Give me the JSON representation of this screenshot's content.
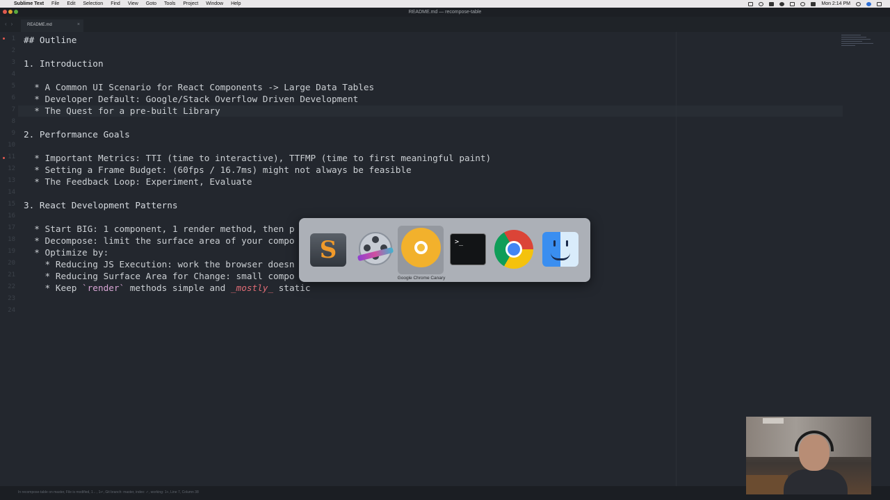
{
  "menubar": {
    "app": "Sublime Text",
    "items": [
      "File",
      "Edit",
      "Selection",
      "Find",
      "View",
      "Goto",
      "Tools",
      "Project",
      "Window",
      "Help"
    ],
    "clock": "Mon 2:14 PM"
  },
  "window": {
    "title": "README.md — recompose-table"
  },
  "tab": {
    "label": "README.md",
    "close": "×"
  },
  "editor": {
    "line_numbers": [
      "1",
      "2",
      "3",
      "4",
      "5",
      "6",
      "7",
      "8",
      "9",
      "10",
      "11",
      "12",
      "13",
      "14",
      "15",
      "16",
      "17",
      "18",
      "19",
      "20",
      "21",
      "22",
      "23",
      "24"
    ],
    "lines": {
      "l1": "## Outline",
      "l3": "1. Introduction",
      "l5": "  * A Common UI Scenario for React Components -> Large Data Tables",
      "l6": "  * Developer Default: Google/Stack Overflow Driven Development",
      "l7": "  * The Quest for a pre-built Library",
      "l9": "2. Performance Goals",
      "l11": "  * Important Metrics: TTI (time to interactive), TTFMP (time to first meaningful paint)",
      "l12": "  * Setting a Frame Budget: (60fps / 16.7ms) might not always be feasible",
      "l13": "  * The Feedback Loop: Experiment, Evaluate",
      "l15": "3. React Development Patterns",
      "l17": "  * Start BIG: 1 component, 1 render method, then p",
      "l18": "  * Decompose: limit the surface area of your compo",
      "l19": "  * Optimize by:",
      "l20": "    * Reducing JS Execution: work the browser doesn",
      "l21": "    * Reducing Surface Area for Change: small compo",
      "l22_prefix": "    * Keep ",
      "l22_code": "`render`",
      "l22_mid": " methods simple and ",
      "l22_em": "_mostly_",
      "l22_suffix": " static"
    }
  },
  "status": {
    "text": "In recompose-table on master, File is modified, 1←, 1↵, Git branch: master, index: ✓, working: 1+, Line 7, Column 38"
  },
  "app_switcher": {
    "apps": [
      {
        "icon": "sublime-text-icon"
      },
      {
        "icon": "video-editor-icon"
      },
      {
        "icon": "chrome-canary-icon"
      },
      {
        "icon": "terminal-icon",
        "glyph": ">_"
      },
      {
        "icon": "chrome-icon"
      },
      {
        "icon": "finder-icon"
      }
    ],
    "selected_label": "Google Chrome Canary"
  },
  "colors": {
    "editor_bg": "#23272e",
    "text": "#ccd0d4",
    "markdown_code": "#d9a6d5",
    "markdown_emphasis": "#e06c75",
    "modified_dot": "#e5594f"
  }
}
